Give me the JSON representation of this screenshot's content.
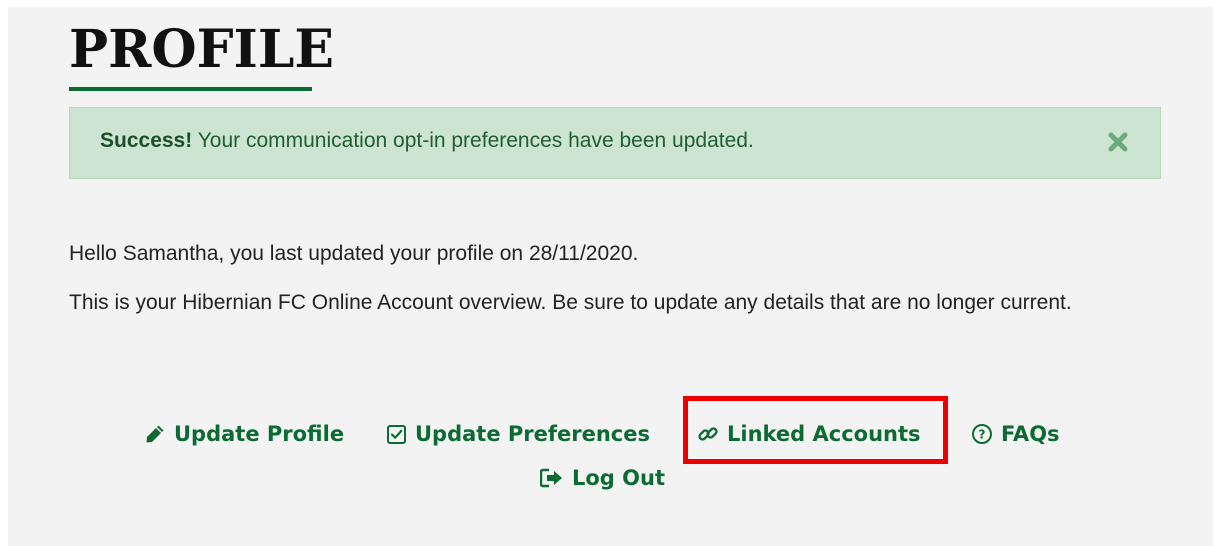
{
  "page": {
    "title": "PROFILE"
  },
  "alert": {
    "strong": "Success!",
    "message": " Your communication opt-in preferences have been updated.",
    "close_icon": "close-x-icon"
  },
  "intro": {
    "greeting": "Hello Samantha, you last updated your profile on 28/11/2020.",
    "overview": "This is your Hibernian FC Online Account overview. Be sure to update any details that are no longer current."
  },
  "actions": {
    "update_profile": {
      "label": "Update Profile",
      "icon": "pencil-icon"
    },
    "update_preferences": {
      "label": "Update Preferences",
      "icon": "checkbox-icon"
    },
    "linked_accounts": {
      "label": "Linked Accounts",
      "icon": "link-icon"
    },
    "faqs": {
      "label": "FAQs",
      "icon": "question-circle-icon"
    },
    "log_out": {
      "label": "Log Out",
      "icon": "sign-out-icon"
    }
  },
  "colors": {
    "brand_green": "#0c6b33",
    "alert_background": "#cde4d2",
    "highlight_red": "#ee0000",
    "panel_background": "#f3f3f3"
  }
}
